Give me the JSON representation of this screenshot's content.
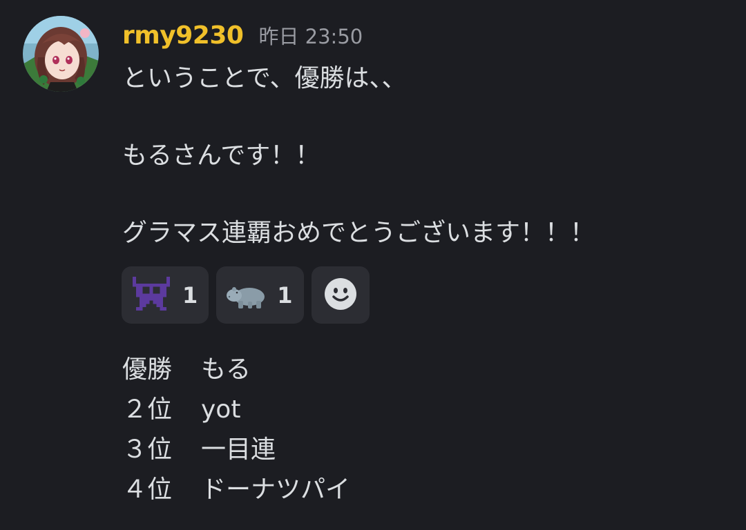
{
  "message": {
    "author": "rmy9230",
    "timestamp": "昨日 23:50",
    "lines": [
      "ということで、優勝は、、",
      "",
      "もるさんです！！",
      "",
      "グラマス連覇おめでとうございます！！！"
    ]
  },
  "reactions": [
    {
      "emoji": "space-invader-emoji",
      "count": "1"
    },
    {
      "emoji": "hippopotamus-emoji",
      "count": "1"
    }
  ],
  "add_reaction_icon": "smiley-add-icon",
  "ranking": [
    {
      "place": "優勝",
      "name": "もる"
    },
    {
      "place": "２位",
      "name": "yot"
    },
    {
      "place": "３位",
      "name": "一目連"
    },
    {
      "place": "４位",
      "name": "ドーナツパイ"
    }
  ],
  "colors": {
    "background": "#1c1d22",
    "username": "#f0c02a",
    "text": "#dbdee1",
    "timestamp": "#9a9ca3",
    "reaction_bg": "#2c2d33"
  }
}
